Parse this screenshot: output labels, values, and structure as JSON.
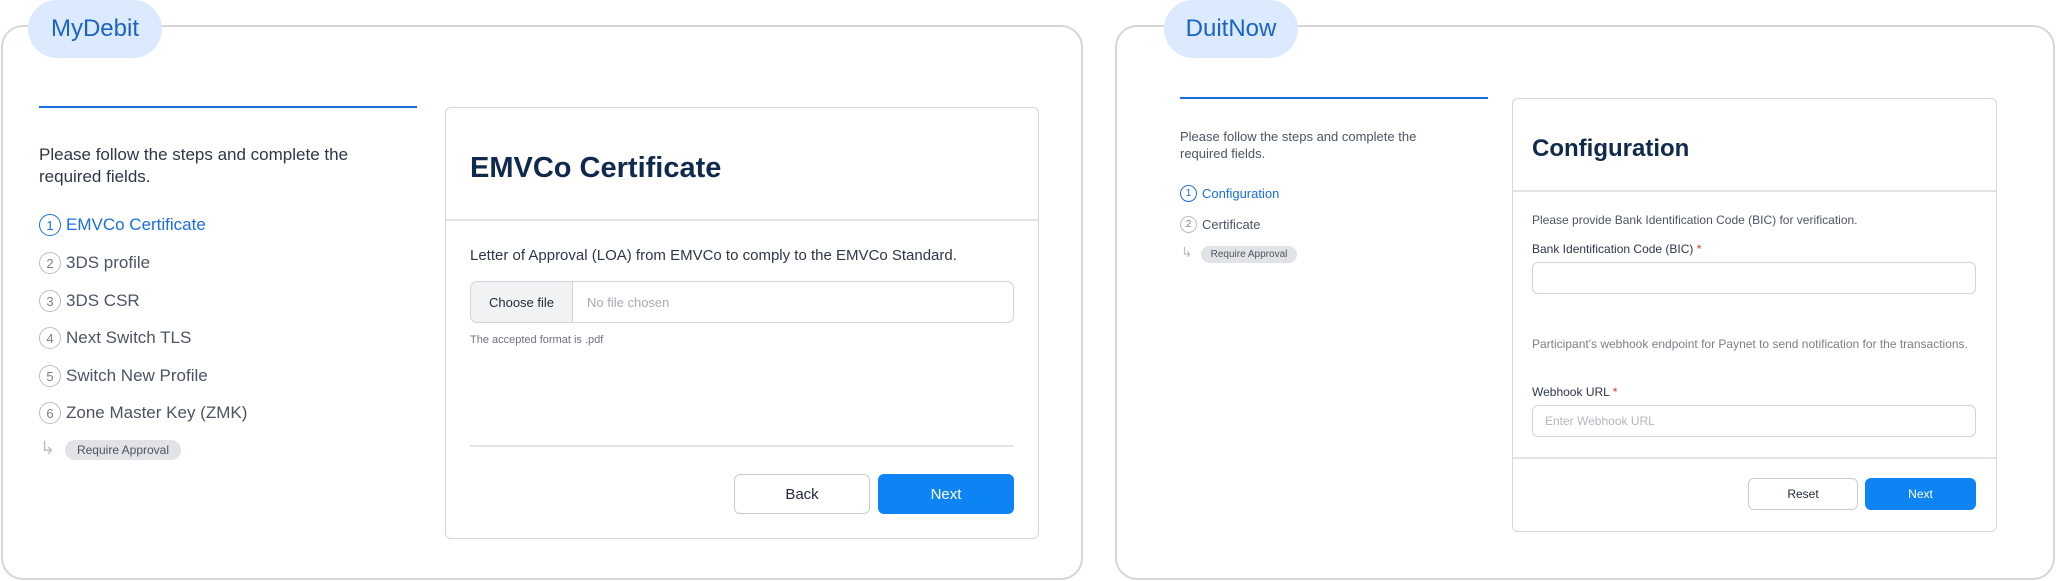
{
  "mydebit": {
    "tab_label": "MyDebit",
    "intro": "Please follow the steps and complete the required fields.",
    "steps": [
      {
        "num": "1",
        "label": "EMVCo Certificate"
      },
      {
        "num": "2",
        "label": "3DS profile"
      },
      {
        "num": "3",
        "label": "3DS CSR"
      },
      {
        "num": "4",
        "label": "Next Switch TLS"
      },
      {
        "num": "5",
        "label": "Switch New Profile"
      },
      {
        "num": "6",
        "label": "Zone Master Key (ZMK)"
      }
    ],
    "approval_arrow": "↳",
    "approval_badge": "Require Approval",
    "card": {
      "title": "EMVCo Certificate",
      "description": "Letter of Approval (LOA) from EMVCo to comply to the EMVCo Standard.",
      "choose_file": "Choose file",
      "file_status": "No file chosen",
      "hint": "The accepted format is .pdf",
      "back": "Back",
      "next": "Next"
    }
  },
  "duitnow": {
    "tab_label": "DuitNow",
    "intro": "Please follow the steps and complete the required fields.",
    "steps": [
      {
        "num": "1",
        "label": "Configuration"
      },
      {
        "num": "2",
        "label": "Certificate"
      }
    ],
    "approval_arrow": "↳",
    "approval_badge": "Require Approval",
    "card": {
      "title": "Configuration",
      "bic_help": "Please provide Bank Identification Code (BIC) for verification.",
      "bic_label": "Bank Identification Code (BIC)",
      "required_mark": "*",
      "bic_value": "",
      "webhook_help": "Participant's webhook endpoint for Paynet to send notification for the transactions.",
      "webhook_label": "Webhook URL",
      "webhook_placeholder": "Enter Webhook URL",
      "reset": "Reset",
      "next": "Next"
    }
  },
  "colors": {
    "accent": "#0c84f4",
    "active_step": "#1a6fe0",
    "pill_bg": "#dbeafd",
    "required": "#e0342f"
  }
}
